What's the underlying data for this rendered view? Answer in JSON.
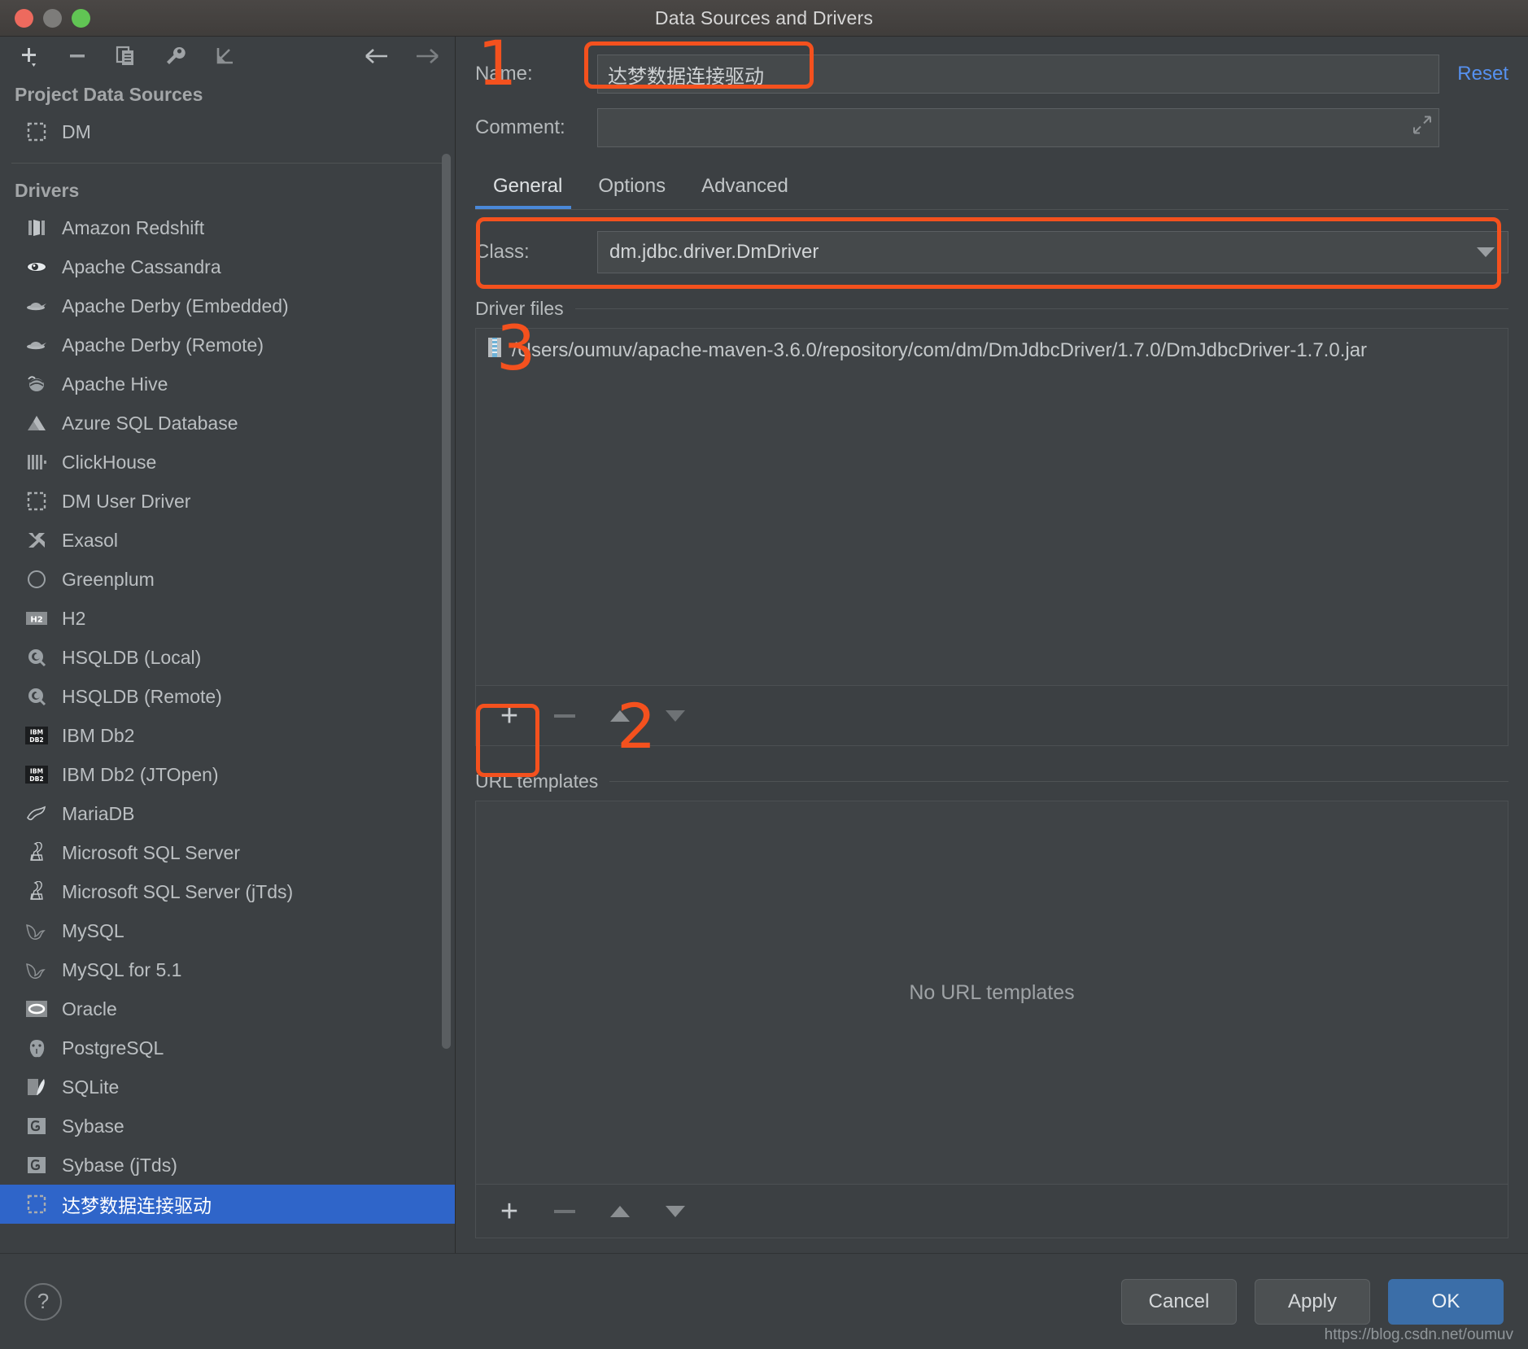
{
  "window": {
    "title": "Data Sources and Drivers",
    "traffic_lights": [
      "close",
      "minimize",
      "maximize"
    ]
  },
  "sidebar": {
    "toolbar": [
      {
        "name": "add-data-source-button",
        "icon": "plus-dropdown-icon"
      },
      {
        "name": "remove-data-source-button",
        "icon": "minus-icon"
      },
      {
        "name": "duplicate-button",
        "icon": "copy-icon"
      },
      {
        "name": "properties-button",
        "icon": "wrench-icon"
      },
      {
        "name": "import-button",
        "icon": "import-arrow-icon"
      },
      {
        "name": "back-button",
        "icon": "arrow-left-icon"
      },
      {
        "name": "forward-button",
        "icon": "arrow-right-icon"
      }
    ],
    "project_header": "Project Data Sources",
    "project_items": [
      {
        "label": "DM",
        "icon": "dm-icon"
      }
    ],
    "drivers_header": "Drivers",
    "drivers": [
      {
        "label": "Amazon Redshift",
        "icon": "redshift-icon"
      },
      {
        "label": "Apache Cassandra",
        "icon": "cassandra-icon"
      },
      {
        "label": "Apache Derby (Embedded)",
        "icon": "derby-icon"
      },
      {
        "label": "Apache Derby (Remote)",
        "icon": "derby-icon"
      },
      {
        "label": "Apache Hive",
        "icon": "hive-icon"
      },
      {
        "label": "Azure SQL Database",
        "icon": "azure-icon"
      },
      {
        "label": "ClickHouse",
        "icon": "clickhouse-icon"
      },
      {
        "label": "DM User Driver",
        "icon": "dm-icon"
      },
      {
        "label": "Exasol",
        "icon": "exasol-icon"
      },
      {
        "label": "Greenplum",
        "icon": "greenplum-icon"
      },
      {
        "label": "H2",
        "icon": "h2-icon"
      },
      {
        "label": "HSQLDB (Local)",
        "icon": "hsqldb-icon"
      },
      {
        "label": "HSQLDB (Remote)",
        "icon": "hsqldb-icon"
      },
      {
        "label": "IBM Db2",
        "icon": "db2-icon"
      },
      {
        "label": "IBM Db2 (JTOpen)",
        "icon": "db2-icon"
      },
      {
        "label": "MariaDB",
        "icon": "mariadb-icon"
      },
      {
        "label": "Microsoft SQL Server",
        "icon": "mssql-icon"
      },
      {
        "label": "Microsoft SQL Server (jTds)",
        "icon": "mssql-icon"
      },
      {
        "label": "MySQL",
        "icon": "mysql-icon"
      },
      {
        "label": "MySQL for 5.1",
        "icon": "mysql-icon"
      },
      {
        "label": "Oracle",
        "icon": "oracle-icon"
      },
      {
        "label": "PostgreSQL",
        "icon": "postgresql-icon"
      },
      {
        "label": "SQLite",
        "icon": "sqlite-icon"
      },
      {
        "label": "Sybase",
        "icon": "sybase-icon"
      },
      {
        "label": "Sybase (jTds)",
        "icon": "sybase-icon"
      },
      {
        "label": "达梦数据连接驱动",
        "icon": "dm-icon",
        "selected": true
      }
    ]
  },
  "pane": {
    "name_label": "Name:",
    "name_value": "达梦数据连接驱动",
    "comment_label": "Comment:",
    "comment_value": "",
    "reset_label": "Reset",
    "tabs": [
      {
        "label": "General",
        "active": true
      },
      {
        "label": "Options",
        "active": false
      },
      {
        "label": "Advanced",
        "active": false
      }
    ],
    "class_label": "Class:",
    "class_value": "dm.jdbc.driver.DmDriver",
    "driver_files_label": "Driver files",
    "driver_files": [
      "/Users/oumuv/apache-maven-3.6.0/repository/com/dm/DmJdbcDriver/1.7.0/DmJdbcDriver-1.7.0.jar"
    ],
    "url_templates_label": "URL templates",
    "url_templates_empty": "No URL templates"
  },
  "footer": {
    "help_label": "?",
    "cancel_label": "Cancel",
    "apply_label": "Apply",
    "ok_label": "OK",
    "watermark": "https://blog.csdn.net/oumuv"
  },
  "annotations": [
    {
      "number": "1",
      "target": "name-field"
    },
    {
      "number": "2",
      "target": "add-driver-file-button"
    },
    {
      "number": "3",
      "target": "class-row"
    }
  ],
  "colors": {
    "accent_blue": "#2f65c9",
    "link_blue": "#5691f0",
    "annotation_orange": "#f4511e",
    "ok_button": "#3b6ea8"
  }
}
